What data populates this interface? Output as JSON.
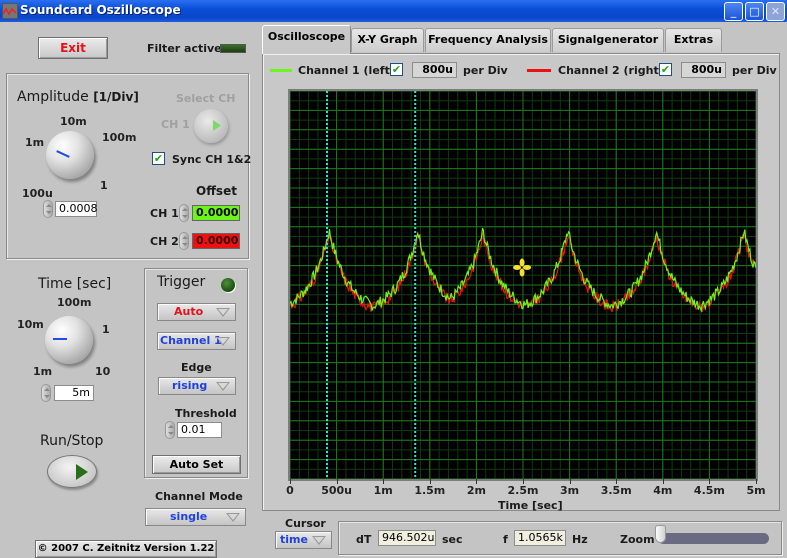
{
  "window": {
    "title": "Soundcard Oszilloscope",
    "controls": {
      "minimize": "_",
      "maximize": "□",
      "close": "✕"
    }
  },
  "left_panel": {
    "exit_label": "Exit",
    "filter_active_label": "Filter active",
    "amplitude": {
      "title": "Amplitude",
      "unit": "[1/Div]",
      "knob_ticks": [
        "100u",
        "1m",
        "10m",
        "100m",
        "1"
      ],
      "value": "0.0008"
    },
    "select_ch": {
      "label": "Select CH",
      "ch_label": "CH 1"
    },
    "sync": {
      "label": "Sync CH 1&2",
      "checked": true
    },
    "offset": {
      "label": "Offset",
      "ch1": {
        "label": "CH 1",
        "value": "0.0000",
        "color": "#6cf51a"
      },
      "ch2": {
        "label": "CH 2",
        "value": "0.0000",
        "color": "#ee1111"
      }
    },
    "time": {
      "title": "Time [sec]",
      "knob_ticks": [
        "1m",
        "10m",
        "100m",
        "1",
        "10"
      ],
      "value": "5m"
    },
    "trigger": {
      "title": "Trigger",
      "mode": "Auto",
      "source": "Channel 1",
      "edge_label": "Edge",
      "edge": "rising",
      "threshold_label": "Threshold",
      "threshold": "0.01",
      "autoset_label": "Auto Set"
    },
    "run_stop_label": "Run/Stop",
    "channel_mode": {
      "label": "Channel Mode",
      "value": "single"
    },
    "copyright": "© 2007   C. Zeitnitz Version 1.22"
  },
  "tabs": [
    {
      "label": "Oscilloscope",
      "active": true
    },
    {
      "label": "X-Y Graph",
      "active": false
    },
    {
      "label": "Frequency Analysis",
      "active": false
    },
    {
      "label": "Signalgenerator",
      "active": false
    },
    {
      "label": "Extras",
      "active": false
    }
  ],
  "channels": {
    "ch1": {
      "label": "Channel 1 (left)",
      "enabled": true,
      "per_div": "800u",
      "per_div_label": "per Div",
      "color": "#6cf51a"
    },
    "ch2": {
      "label": "Channel 2 (right)",
      "enabled": true,
      "per_div": "800u",
      "per_div_label": "per Div",
      "color": "#ee1111"
    }
  },
  "cursor_bar": {
    "cursor_label": "Cursor",
    "cursor_mode": "time",
    "dt_label": "dT",
    "dt_value": "946.502u",
    "dt_unit": "sec",
    "f_label": "f",
    "f_value": "1.0565k",
    "f_unit": "Hz",
    "zoom_label": "Zoom",
    "zoom_level": 0
  },
  "chart_data": {
    "type": "line",
    "title": "",
    "xlabel": "Time [sec]",
    "ylabel": "",
    "x_ticks": [
      "0",
      "500u",
      "1m",
      "1.5m",
      "2m",
      "2.5m",
      "3m",
      "3.5m",
      "4m",
      "4.5m",
      "5m"
    ],
    "xlim": [
      0,
      0.005
    ],
    "ylim_divisions": [
      -10,
      10
    ],
    "grid": true,
    "cursors_x": [
      0.000397,
      0.0013435
    ],
    "cursor_marker": {
      "x": 0.00249,
      "y_div": 0.9
    },
    "series": [
      {
        "name": "Channel 1 (left)",
        "color": "#6cf51a",
        "shape": "periodic cusp-shaped peaks with noise",
        "period_s": 0.000946,
        "peaks_x": [
          0.00042,
          0.00137,
          0.00207,
          0.00298,
          0.00393,
          0.00487
        ],
        "peak_y_div": 2.8,
        "trough_y_div": -1.5,
        "noise_div": 0.3
      },
      {
        "name": "Channel 2 (right)",
        "color": "#ee1111",
        "shape": "nearly identical to channel 1 with independent noise",
        "period_s": 0.000946,
        "peak_y_div": 2.6,
        "trough_y_div": -1.6,
        "noise_div": 0.3
      }
    ]
  }
}
